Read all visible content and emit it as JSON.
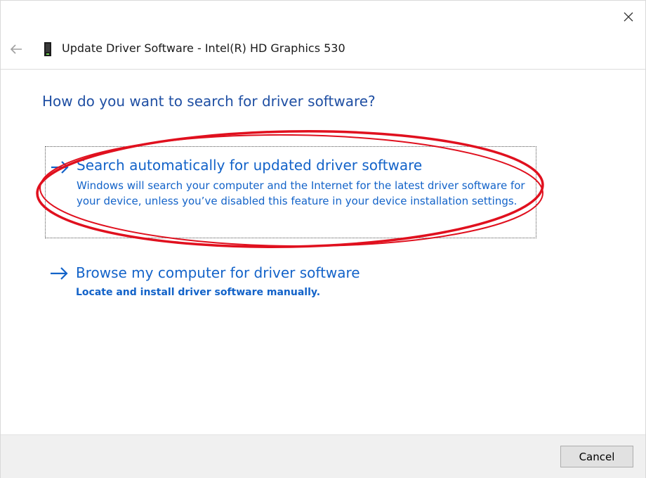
{
  "window": {
    "title": "Update Driver Software - Intel(R) HD Graphics 530",
    "close_icon": "close-icon",
    "back_icon": "back-arrow-icon",
    "device_icon": "display-adapter-icon"
  },
  "main": {
    "question": "How do you want to search for driver software?",
    "options": [
      {
        "title": "Search automatically for updated driver software",
        "description": "Windows will search your computer and the Internet for the latest driver software for your device, unless you’ve disabled this feature in your device installation settings.",
        "icon": "arrow-right-icon",
        "focused": true
      },
      {
        "title": "Browse my computer for driver software",
        "description": "Locate and install driver software manually.",
        "icon": "arrow-right-icon",
        "focused": false
      }
    ]
  },
  "footer": {
    "cancel_label": "Cancel"
  },
  "colors": {
    "heading": "#1f4fa3",
    "link": "#1363c9",
    "annotation": "#e0101e",
    "footer_bg": "#f0f0f0"
  }
}
